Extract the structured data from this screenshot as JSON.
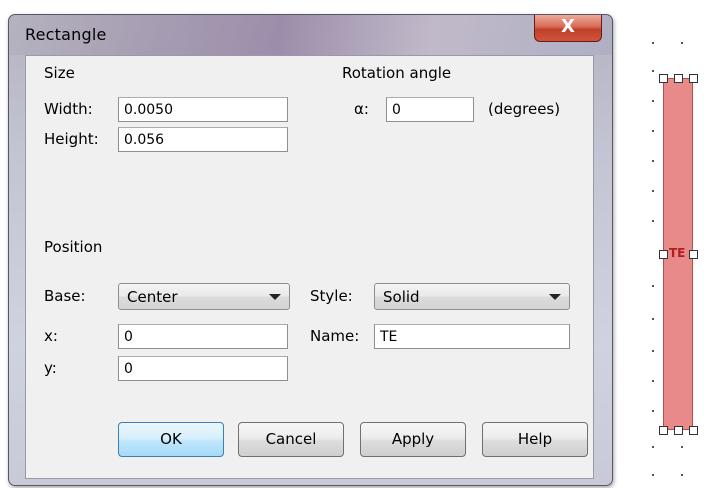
{
  "dialog": {
    "title": "Rectangle",
    "close_glyph": "X",
    "size_group": {
      "label": "Size",
      "width_label": "Width:",
      "width_value": "0.0050",
      "height_label": "Height:",
      "height_value": "0.056"
    },
    "rotation_group": {
      "label": "Rotation angle",
      "alpha_label": "α:",
      "alpha_value": "0",
      "unit_label": "(degrees)"
    },
    "position_group": {
      "label": "Position",
      "base_label": "Base:",
      "base_value": "Center",
      "x_label": "x:",
      "x_value": "0",
      "y_label": "y:",
      "y_value": "0"
    },
    "style_label": "Style:",
    "style_value": "Solid",
    "name_label": "Name:",
    "name_value": "TE",
    "buttons": {
      "ok": "OK",
      "cancel": "Cancel",
      "apply": "Apply",
      "help": "Help"
    }
  },
  "shape_preview": {
    "label": "TE",
    "fill_color": "#e98a8a"
  }
}
